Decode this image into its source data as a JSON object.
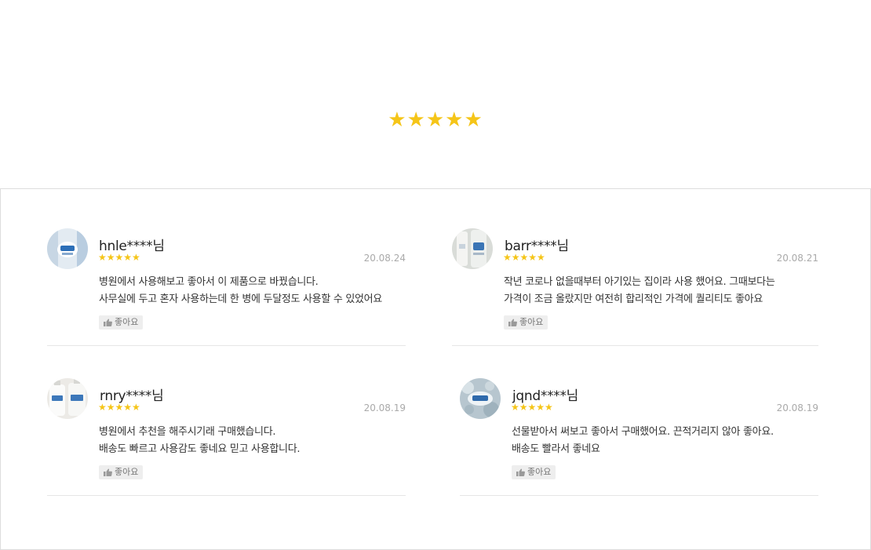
{
  "summary": {
    "rating_stars": "★★★★★",
    "star_color": "#f5c518"
  },
  "reviews": [
    {
      "user": "hnle****님",
      "stars": "★★★★★",
      "date": "20.08.24",
      "lines": [
        "병원에서 사용해보고 좋아서 이 제품으로 바꿨습니다.",
        "사무실에 두고 혼자 사용하는데 한 병에 두달정도 사용할 수 있었어요"
      ],
      "like_label": "좋아요",
      "avatar_icon": "product-photo-icon"
    },
    {
      "user": "barr****님",
      "stars": "★★★★★",
      "date": "20.08.21",
      "lines": [
        "작년 코로나 없을때부터 아기있는 집이라 사용 했어요. 그때보다는",
        "가격이 조금 올랐지만 여전히 합리적인 가격에 퀄리티도 좋아요"
      ],
      "like_label": "좋아요",
      "avatar_icon": "product-photo-icon"
    },
    {
      "user": "rnry****님",
      "stars": "★★★★★",
      "date": "20.08.19",
      "lines": [
        "병원에서 추천을 해주시기래 구매했습니다.",
        "배송도 빠르고 사용감도 좋네요 믿고 사용합니다."
      ],
      "like_label": "좋아요",
      "avatar_icon": "product-photo-icon"
    },
    {
      "user": "jqnd****님",
      "stars": "★★★★★",
      "date": "20.08.19",
      "lines": [
        "선물받아서 써보고 좋아서 구매했어요. 끈적거리지 않아 좋아요.",
        "배송도 빨라서 좋네요"
      ],
      "like_label": "좋아요",
      "avatar_icon": "product-photo-icon"
    }
  ]
}
